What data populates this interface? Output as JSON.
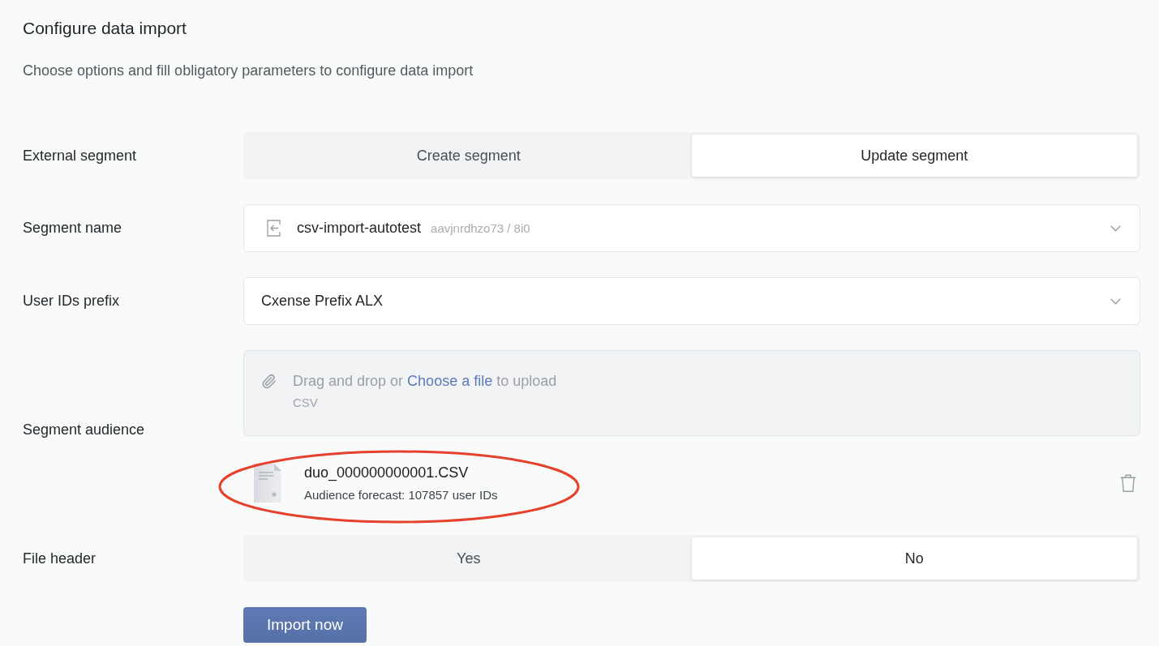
{
  "title": "Configure data import",
  "subtitle": "Choose options and fill obligatory parameters to configure data import",
  "fields": [
    {
      "kind": "segmented",
      "label": "External segment",
      "options": [
        {
          "label": "Create segment",
          "selected": false
        },
        {
          "label": "Update segment",
          "selected": true
        }
      ]
    },
    {
      "kind": "segment-select",
      "label": "Segment name",
      "value": "csv-import-autotest",
      "hint": "aavjnrdhzo73 / 8i0"
    },
    {
      "kind": "select",
      "label": "User IDs prefix",
      "value": "Cxense Prefix ALX"
    },
    {
      "kind": "upload",
      "label": "Segment audience",
      "prompt_before": "Drag and drop or",
      "link": "Choose a file",
      "prompt_after": "to upload",
      "formats": "CSV",
      "files": [
        {
          "name": "duo_000000000001.CSV",
          "forecast": "Audience forecast: 107857 user IDs",
          "highlighted": true
        }
      ]
    },
    {
      "kind": "segmented",
      "label": "File header",
      "options": [
        {
          "label": "Yes",
          "selected": false
        },
        {
          "label": "No",
          "selected": true
        }
      ]
    }
  ],
  "import_button": "Import now"
}
